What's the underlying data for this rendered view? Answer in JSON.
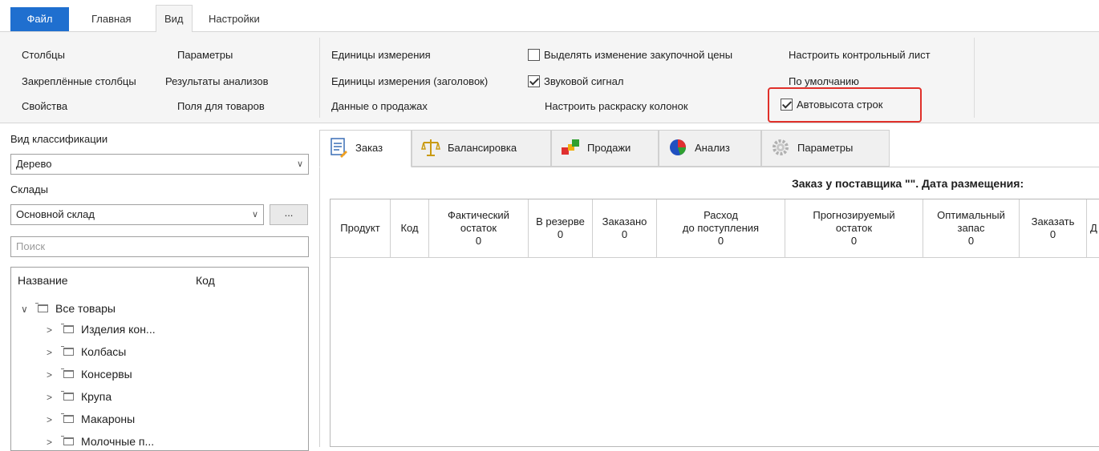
{
  "ribbon_tabs": {
    "file": "Файл",
    "home": "Главная",
    "view": "Вид",
    "settings": "Настройки"
  },
  "ribbon": {
    "columns": "Столбцы",
    "frozen_columns": "Закреплённые столбцы",
    "properties": "Свойства",
    "parameters": "Параметры",
    "analysis_results": "Результаты анализов",
    "product_fields": "Поля для товаров",
    "units": "Единицы измерения",
    "units_header": "Единицы измерения (заголовок)",
    "sales_data": "Данные о продажах",
    "highlight_price": "Выделять изменение закупочной цены",
    "sound_signal": "Звуковой сигнал",
    "column_coloring": "Настроить раскраску колонок",
    "checklist": "Настроить контрольный лист",
    "default": "По умолчанию",
    "auto_row_height": "Автовысота строк"
  },
  "checkbox_states": {
    "highlight_price": false,
    "sound_signal": true,
    "auto_row_height": true
  },
  "left": {
    "classification_label": "Вид классификации",
    "classification_value": "Дерево",
    "warehouses_label": "Склады",
    "warehouse_value": "Основной склад",
    "more_button": "...",
    "search_placeholder": "Поиск",
    "tree_col_name": "Название",
    "tree_col_code": "Код",
    "tree_root": "Все товары",
    "tree_items": [
      "Изделия кон...",
      "Колбасы",
      "Консервы",
      "Крупа",
      "Макароны",
      "Молочные п..."
    ]
  },
  "main_tabs": [
    "Заказ",
    "Балансировка",
    "Продажи",
    "Анализ",
    "Параметры"
  ],
  "order_title": "Заказ у поставщика \"\". Дата размещения:",
  "grid_columns": [
    {
      "line1": "Продукт",
      "line2": "",
      "total": ""
    },
    {
      "line1": "Код",
      "line2": "",
      "total": ""
    },
    {
      "line1": "Фактический",
      "line2": "остаток",
      "total": "0"
    },
    {
      "line1": "В резерве",
      "line2": "",
      "total": "0"
    },
    {
      "line1": "Заказано",
      "line2": "",
      "total": "0"
    },
    {
      "line1": "Расход",
      "line2": "до поступления",
      "total": "0"
    },
    {
      "line1": "Прогнозируемый",
      "line2": "остаток",
      "total": "0"
    },
    {
      "line1": "Оптимальный",
      "line2": "запас",
      "total": "0"
    },
    {
      "line1": "Заказать",
      "line2": "",
      "total": "0"
    },
    {
      "line1": "Д",
      "line2": "",
      "total": ""
    }
  ],
  "colors": {
    "file_tab": "#1f6fcf",
    "highlight": "#e0302a",
    "ribbon_bg": "#f5f5f5"
  }
}
